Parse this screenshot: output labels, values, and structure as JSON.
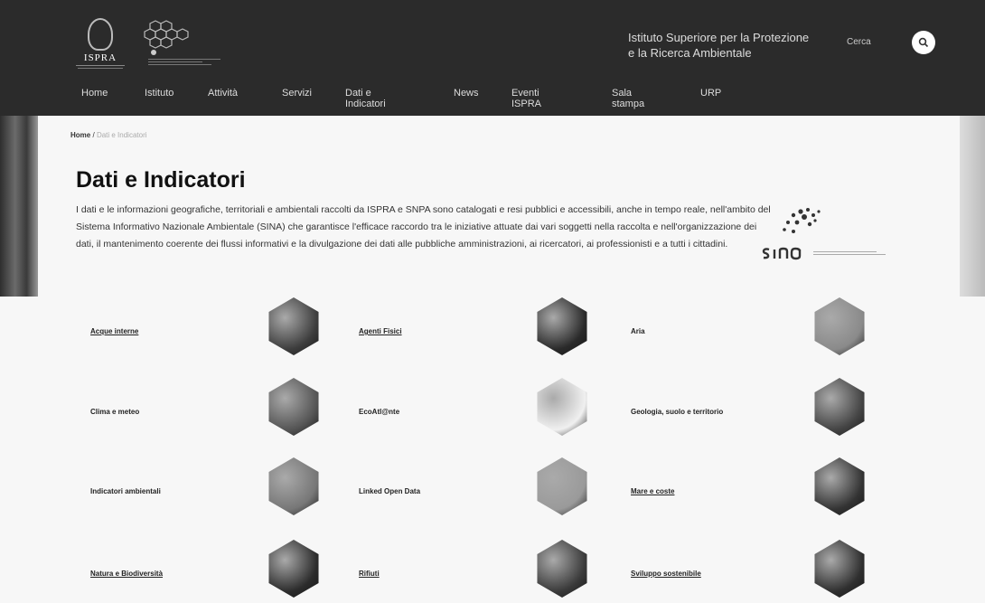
{
  "header": {
    "logo_name": "ISPRA",
    "institute_line1": "Istituto Superiore per la Protezione",
    "institute_line2": "e la Ricerca Ambientale",
    "search_label": "Cerca"
  },
  "nav": [
    {
      "label": "Home"
    },
    {
      "label": "Istituto"
    },
    {
      "label": "Attività"
    },
    {
      "label": "Servizi"
    },
    {
      "label": "Dati e Indicatori"
    },
    {
      "label": "News"
    },
    {
      "label": "Eventi ISPRA"
    },
    {
      "label": "Sala stampa"
    },
    {
      "label": "URP"
    }
  ],
  "breadcrumb": {
    "home": "Home",
    "separator": "/"
  },
  "page": {
    "title": "Dati e Indicatori",
    "intro": "I dati e le informazioni geografiche, territoriali e ambientali raccolti da ISPRA e SNPA sono catalogati e resi pubblici e accessibili, anche in tempo reale, nell'ambito del Sistema Informativo Nazionale Ambientale (SINA) che garantisce l'efficace raccordo tra le iniziative attuate dai vari soggetti nella raccolta e nell'organizzazione dei dati, il mantenimento coerente dei flussi informativi e la divulgazione dei dati alle pubbliche amministrazioni, ai ricercatori, ai professionisti e a tutti i cittadini."
  },
  "sina": {
    "word": "SINA"
  },
  "categories": [
    {
      "label": "Acque interne",
      "icon": "water-icon",
      "color": "#3d3d3d"
    },
    {
      "label": "Agenti Fisici",
      "icon": "physics-icon",
      "color": "#2a2a2a"
    },
    {
      "label": "Aria",
      "icon": "air-icon",
      "color": "#8a8a8a"
    },
    {
      "label": "Clima e meteo",
      "icon": "climate-icon",
      "color": "#555"
    },
    {
      "label": "EcoAtl@nte",
      "icon": "map-icon",
      "color": "#f0f0f0"
    },
    {
      "label": "Geologia, suolo e territorio",
      "icon": "geology-icon",
      "color": "#444"
    },
    {
      "label": "Indicatori ambientali",
      "icon": "chart-icon",
      "color": "#777"
    },
    {
      "label": "Linked Open Data",
      "icon": "lod-icon",
      "color": "#9a9a9a"
    },
    {
      "label": "Mare e coste",
      "icon": "sea-icon",
      "color": "#333"
    },
    {
      "label": "Natura e Biodiversità",
      "icon": "nature-icon",
      "color": "#2c2c2c"
    },
    {
      "label": "Rifiuti",
      "icon": "waste-icon",
      "color": "#3a3a3a"
    },
    {
      "label": "Sviluppo sostenibile",
      "icon": "sustainability-icon",
      "color": "#2f2f2f"
    }
  ]
}
